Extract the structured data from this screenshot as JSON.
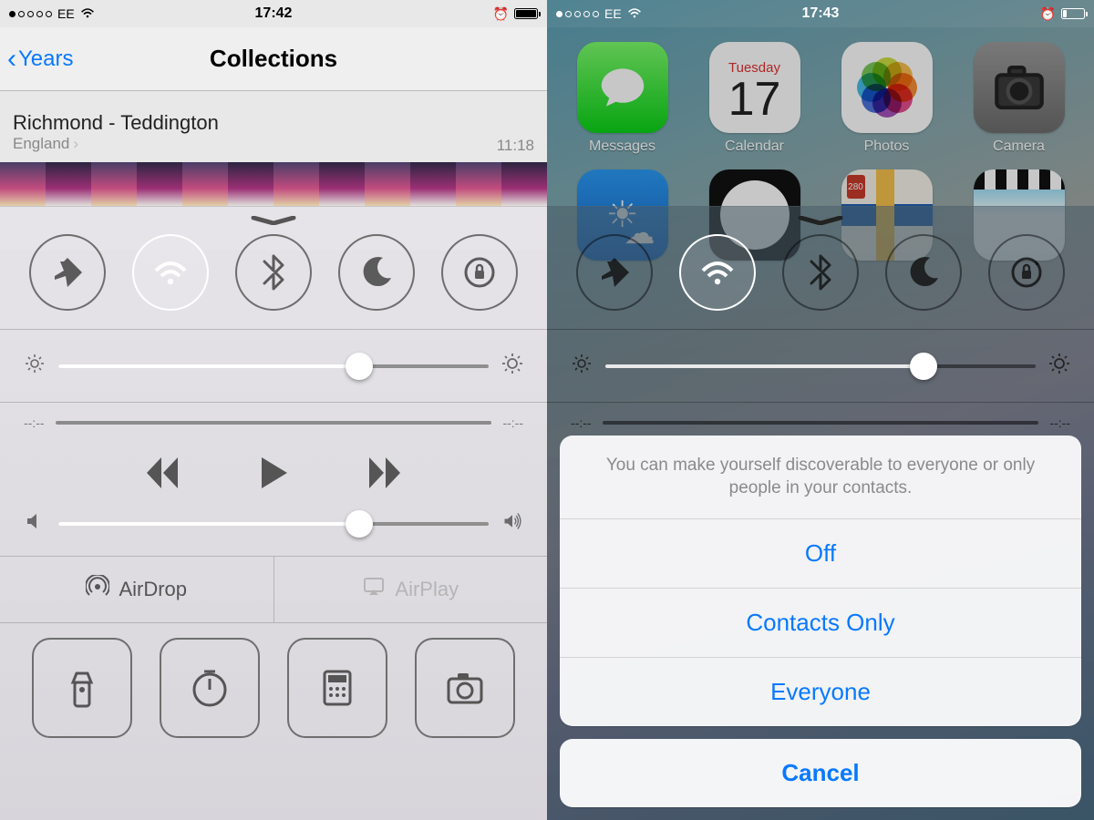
{
  "left": {
    "status": {
      "carrier": "EE",
      "time": "17:42",
      "battery_pct": 95
    },
    "nav": {
      "back": "Years",
      "title": "Collections"
    },
    "moment": {
      "title": "Richmond - Teddington",
      "subtitle": "England",
      "time": "11:18"
    },
    "cc": {
      "brightness_pct": 70,
      "time_elapsed": "--:--",
      "time_remain": "--:--",
      "volume_pct": 70,
      "airdrop": "AirDrop",
      "airplay": "AirPlay"
    }
  },
  "right": {
    "status": {
      "carrier": "EE",
      "time": "17:43",
      "battery_pct": 20
    },
    "apps": {
      "messages": "Messages",
      "calendar": "Calendar",
      "calendar_dow": "Tuesday",
      "calendar_day": "17",
      "photos": "Photos",
      "camera": "Camera"
    },
    "cc": {
      "brightness_pct": 74,
      "time_elapsed": "--:--",
      "time_remain": "--:--"
    },
    "sheet": {
      "header": "You can make yourself discoverable to everyone or only people in your contacts.",
      "opt_off": "Off",
      "opt_contacts": "Contacts Only",
      "opt_everyone": "Everyone",
      "cancel": "Cancel"
    }
  }
}
